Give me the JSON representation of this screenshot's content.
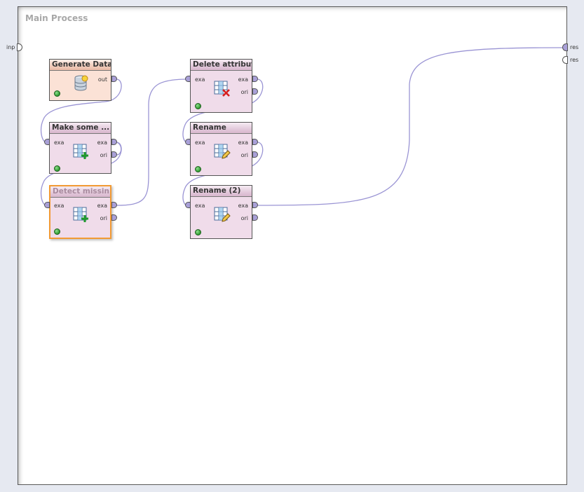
{
  "process": {
    "title": "Main Process"
  },
  "process_ports": {
    "input": "inp",
    "outputs": [
      "res",
      "res"
    ]
  },
  "operators": {
    "generate_data": {
      "title": "Generate Data",
      "ports": {
        "out": "out"
      },
      "icon": "database-icon"
    },
    "make_some": {
      "title": "Make some ...",
      "ports": {
        "in": "exa",
        "out1": "exa",
        "out2": "ori"
      },
      "icon": "table-add-icon"
    },
    "detect_missing": {
      "title": "Detect missin...",
      "ports": {
        "in": "exa",
        "out1": "exa",
        "out2": "ori"
      },
      "icon": "table-add-icon"
    },
    "delete_attributes": {
      "title": "Delete attribut...",
      "ports": {
        "in": "exa",
        "out1": "exa",
        "out2": "ori"
      },
      "icon": "table-delete-icon"
    },
    "rename": {
      "title": "Rename",
      "ports": {
        "in": "exa",
        "out1": "exa",
        "out2": "ori"
      },
      "icon": "table-edit-icon"
    },
    "rename2": {
      "title": "Rename (2)",
      "ports": {
        "in": "exa",
        "out1": "exa",
        "out2": "ori"
      },
      "icon": "table-edit-icon"
    }
  },
  "colors": {
    "port": "#a9a0d8",
    "wire": "#9a94d4",
    "operator": "#f0dcea",
    "source_operator": "#fbe2d6",
    "selection": "#f29a33",
    "status_ok": "#2e9a2e"
  }
}
